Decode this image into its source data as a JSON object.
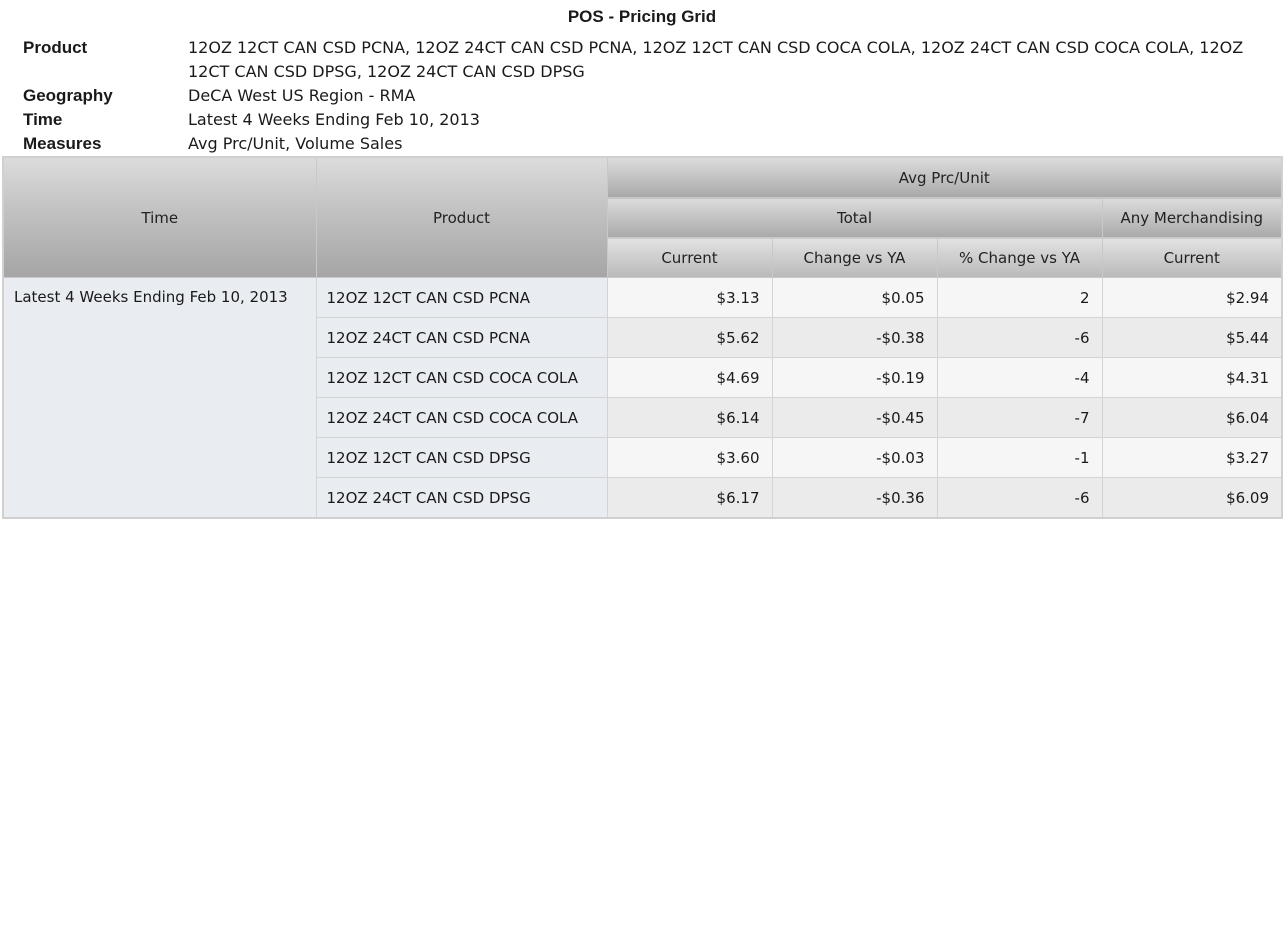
{
  "report": {
    "title": "POS - Pricing Grid"
  },
  "meta": {
    "product_label": "Product",
    "product_value": "12OZ 12CT CAN CSD PCNA, 12OZ 24CT CAN CSD PCNA, 12OZ 12CT CAN CSD COCA COLA, 12OZ 24CT CAN CSD COCA COLA, 12OZ 12CT CAN CSD DPSG, 12OZ 24CT CAN CSD DPSG",
    "geography_label": "Geography",
    "geography_value": "DeCA West US Region - RMA",
    "time_label": "Time",
    "time_value": "Latest 4 Weeks Ending Feb 10, 2013",
    "measures_label": "Measures",
    "measures_value": "Avg Prc/Unit, Volume Sales"
  },
  "grid": {
    "headers": {
      "time": "Time",
      "product": "Product",
      "measure": "Avg Prc/Unit",
      "total": "Total",
      "any_merch": "Any Merchandising",
      "current": "Current",
      "change_vs_ya": "Change vs YA",
      "pct_change_vs_ya": "% Change vs YA",
      "merch_current": "Current"
    },
    "time_value": "Latest 4 Weeks Ending Feb 10, 2013",
    "rows": [
      {
        "product": "12OZ 12CT CAN CSD PCNA",
        "current": "$3.13",
        "change": "$0.05",
        "pct_change": "2",
        "merch_current": "$2.94"
      },
      {
        "product": "12OZ 24CT CAN CSD PCNA",
        "current": "$5.62",
        "change": "-$0.38",
        "pct_change": "-6",
        "merch_current": "$5.44"
      },
      {
        "product": "12OZ 12CT CAN CSD COCA COLA",
        "current": "$4.69",
        "change": "-$0.19",
        "pct_change": "-4",
        "merch_current": "$4.31"
      },
      {
        "product": "12OZ 24CT CAN CSD COCA COLA",
        "current": "$6.14",
        "change": "-$0.45",
        "pct_change": "-7",
        "merch_current": "$6.04"
      },
      {
        "product": "12OZ 12CT CAN CSD DPSG",
        "current": "$3.60",
        "change": "-$0.03",
        "pct_change": "-1",
        "merch_current": "$3.27"
      },
      {
        "product": "12OZ 24CT CAN CSD DPSG",
        "current": "$6.17",
        "change": "-$0.36",
        "pct_change": "-6",
        "merch_current": "$6.09"
      }
    ]
  }
}
